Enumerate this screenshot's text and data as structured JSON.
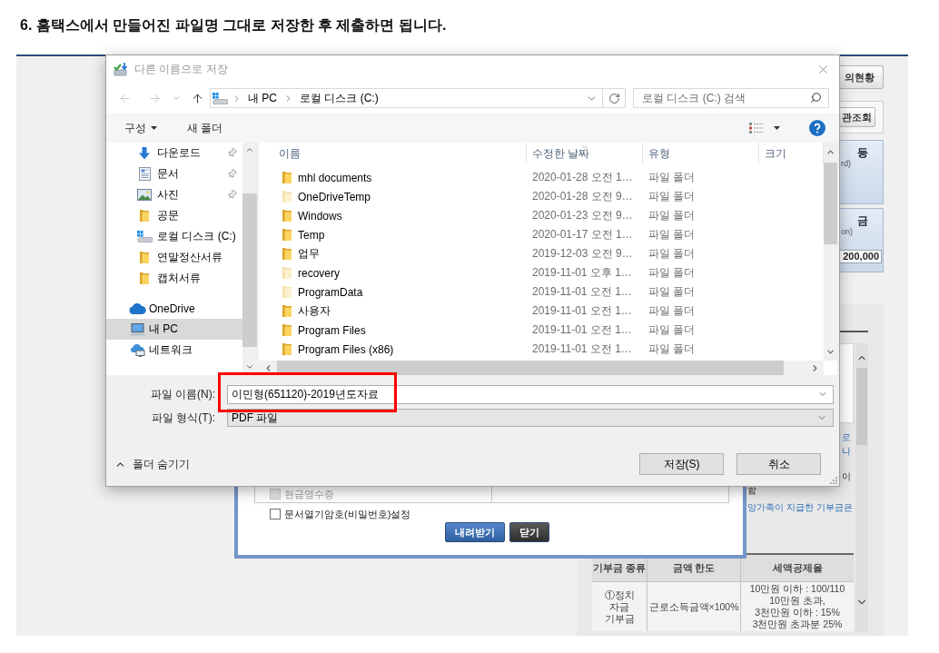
{
  "heading": "6. 홈택스에서 만들어진 파일명 그대로 저장한 후 제출하면 됩니다.",
  "web_page": {
    "buttons": [
      "의현황",
      "관조회"
    ],
    "cards": [
      {
        "title": "등",
        "subtitle": "rd)"
      },
      {
        "title": "금",
        "subtitle": "on)",
        "amount": "200,000"
      }
    ],
    "notes": [
      {
        "text": "로",
        "highlighted": true
      },
      {
        "text": "나",
        "highlighted": true
      },
      {
        "text": "이",
        "highlighted": false
      },
      {
        "text": "함",
        "highlighted": false
      },
      {
        "text": "양가족이 지급한 기부금은",
        "highlighted": true
      }
    ],
    "table": {
      "columns": [
        "기부금 종류",
        "금액 한도",
        "세액공제율"
      ],
      "rows": [
        [
          "①정치\n자금\n기부금",
          "근로소득금액×100%",
          "10만원 이하 : 100/110\n10만원 초과,\n3천만원 이하 : 15%\n3천만원 초과분 25%"
        ]
      ]
    }
  },
  "download_popup": {
    "options": [
      {
        "kind": "table_row",
        "label": "현금영수증",
        "checked": false,
        "disabled": true
      },
      {
        "kind": "plain",
        "label": "문서열기암호(비밀번호)설정",
        "checked": false,
        "disabled": false
      }
    ],
    "buttons": [
      {
        "label": "내려받기",
        "kind": "primary"
      },
      {
        "label": "닫기",
        "kind": "dark"
      }
    ]
  },
  "dialog": {
    "title": "다른 이름으로 저장",
    "active": false,
    "history": {
      "back_disabled": true,
      "forward_disabled": true
    },
    "breadcrumb": [
      "내 PC",
      "로컬 디스크 (C:)"
    ],
    "search": {
      "placeholder": "로컬 디스크 (C:) 검색"
    },
    "toolbar": [
      {
        "label": "구성",
        "kind": "menu"
      },
      {
        "label": "새 폴더",
        "kind": "plain"
      }
    ],
    "quick_access": [
      {
        "label": "다운로드",
        "kind": "downloads",
        "pinned": true,
        "selected": false
      },
      {
        "label": "문서",
        "kind": "documents",
        "pinned": true,
        "selected": false
      },
      {
        "label": "사진",
        "kind": "pictures",
        "pinned": true,
        "selected": false
      },
      {
        "label": "공문",
        "kind": "folder",
        "pinned": false,
        "selected": false
      },
      {
        "label": "로컬 디스크 (C:)",
        "kind": "drive",
        "pinned": false,
        "selected": false
      },
      {
        "label": "연말정산서류",
        "kind": "folder",
        "pinned": false,
        "selected": false
      },
      {
        "label": "캡처서류",
        "kind": "folder",
        "pinned": false,
        "selected": false
      }
    ],
    "locations": [
      {
        "label": "OneDrive",
        "kind": "cloud",
        "selected": false
      },
      {
        "label": "내 PC",
        "kind": "pc",
        "selected": true
      },
      {
        "label": "네트워크",
        "kind": "network",
        "selected": false
      }
    ],
    "columns": [
      {
        "label": "이름",
        "sorted": false
      },
      {
        "label": "수정한 날짜",
        "sorted": true
      },
      {
        "label": "유형",
        "sorted": false
      },
      {
        "label": "크기",
        "sorted": false
      }
    ],
    "files": [
      {
        "name": "mhl documents",
        "modified": "2020-01-28 오전 1…",
        "type": "파일 폴더",
        "hidden": false
      },
      {
        "name": "OneDriveTemp",
        "modified": "2020-01-28 오전 9…",
        "type": "파일 폴더",
        "hidden": true
      },
      {
        "name": "Windows",
        "modified": "2020-01-23 오전 9…",
        "type": "파일 폴더",
        "hidden": false
      },
      {
        "name": "Temp",
        "modified": "2020-01-17 오전 1…",
        "type": "파일 폴더",
        "hidden": false
      },
      {
        "name": "업무",
        "modified": "2019-12-03 오전 9…",
        "type": "파일 폴더",
        "hidden": false
      },
      {
        "name": "recovery",
        "modified": "2019-11-01 오후 1…",
        "type": "파일 폴더",
        "hidden": true
      },
      {
        "name": "ProgramData",
        "modified": "2019-11-01 오전 1…",
        "type": "파일 폴더",
        "hidden": true
      },
      {
        "name": "사용자",
        "modified": "2019-11-01 오전 1…",
        "type": "파일 폴더",
        "hidden": false
      },
      {
        "name": "Program Files",
        "modified": "2019-11-01 오전 1…",
        "type": "파일 폴더",
        "hidden": false
      },
      {
        "name": "Program Files (x86)",
        "modified": "2019-11-01 오전 1…",
        "type": "파일 폴더",
        "hidden": false
      }
    ],
    "file_name": {
      "label": "파일 이름(N):",
      "value": "이민형(651120)-2019년도자료"
    },
    "file_type": {
      "label": "파일 형식(T):",
      "value": "PDF 파일"
    },
    "folder_toggle": "폴더 숨기기",
    "buttons": [
      "저장(S)",
      "취소"
    ]
  }
}
